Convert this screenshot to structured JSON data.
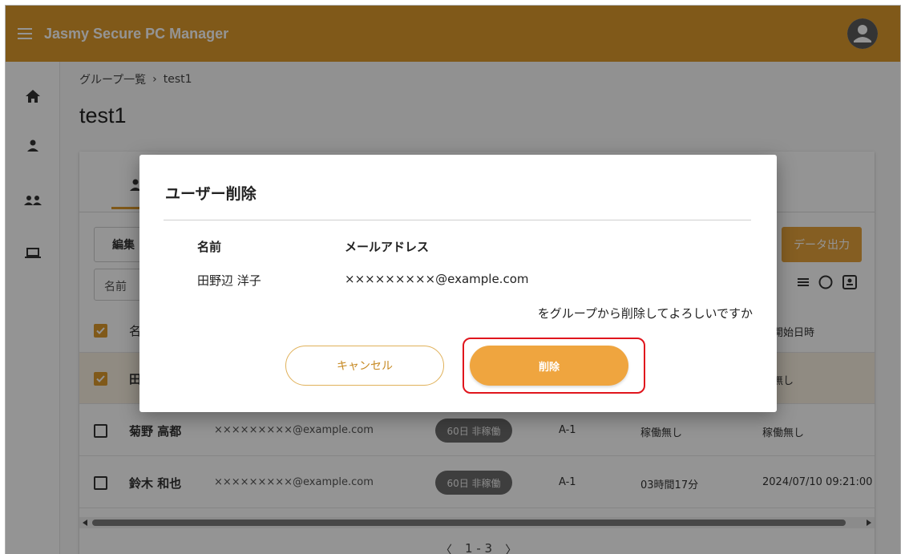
{
  "app": {
    "title": "Jasmy Secure PC Manager"
  },
  "breadcrumb": {
    "parent": "グループ一覧",
    "separator": "›",
    "current": "test1"
  },
  "page": {
    "title": "test1"
  },
  "toolbar": {
    "edit_label": "編集",
    "export_label": "データ出力",
    "filter_label": "名前"
  },
  "table": {
    "header_name": "名",
    "header_start": "働開始日時",
    "rows": [
      {
        "name": "田",
        "selected": true,
        "start": "働無し"
      },
      {
        "name": "菊野 高都",
        "email": "×××××××××@example.com",
        "status": "60日 非稼働",
        "dept": "A-1",
        "time": "稼働無し",
        "start": "稼働無し"
      },
      {
        "name": "鈴木 和也",
        "email": "×××××××××@example.com",
        "status": "60日 非稼働",
        "dept": "A-1",
        "time": "03時間17分",
        "start": "2024/07/10 09:21:00"
      }
    ]
  },
  "pager": {
    "prev": "〈",
    "range": "1 - 3",
    "next": "〉"
  },
  "dialog": {
    "title": "ユーザー削除",
    "col_name": "名前",
    "col_email": "メールアドレス",
    "user_name": "田野辺 洋子",
    "user_email": "×××××××××@example.com",
    "confirm": "をグループから削除してよろしいですか",
    "cancel_label": "キャンセル",
    "delete_label": "削除"
  },
  "colors": {
    "brand": "#dd9a2c",
    "highlight": "#e0151d"
  }
}
